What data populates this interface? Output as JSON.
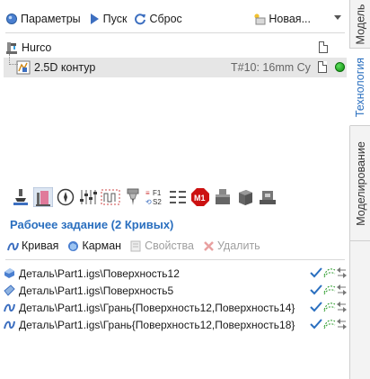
{
  "toolbar": {
    "params_label": "Параметры",
    "run_label": "Пуск",
    "reset_label": "Сброс",
    "new_label": "Новая..."
  },
  "tree": {
    "machine_label": "Hurco",
    "operation_label": "2.5D контур",
    "tool_info": "T#10:  16mm Cy",
    "status_color": "#22b022"
  },
  "work": {
    "title": "Рабочее задание  (2 Кривых)"
  },
  "actions": {
    "curve_label": "Кривая",
    "pocket_label": "Карман",
    "properties_label": "Свойства",
    "delete_label": "Удалить"
  },
  "geometry_items": [
    {
      "label": "Деталь\\Part1.igs\\Поверхность12",
      "icon": "surface-icon"
    },
    {
      "label": "Деталь\\Part1.igs\\Поверхность5",
      "icon": "surface-flat-icon"
    },
    {
      "label": "Деталь\\Part1.igs\\Грань{Поверхность12,Поверхность14}",
      "icon": "curve-icon"
    },
    {
      "label": "Деталь\\Part1.igs\\Грань{Поверхность12,Поверхность18}",
      "icon": "curve-icon"
    }
  ],
  "side_tabs": {
    "model": "Модель",
    "technology": "Технология",
    "modeling": "Моделирование"
  },
  "colors": {
    "accent": "#2a6fbf",
    "selected_row": "#e6e6e6",
    "stop_red": "#cc1111"
  }
}
